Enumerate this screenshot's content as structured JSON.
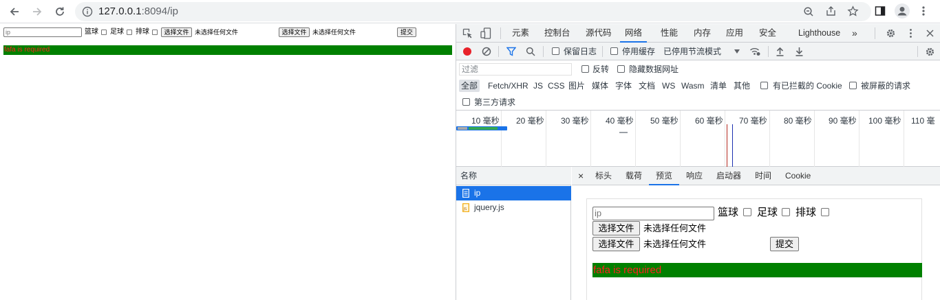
{
  "browser": {
    "url_host": "127.0.0.1",
    "url_rest": ":8094/ip"
  },
  "page": {
    "ip_placeholder": "ip",
    "hobbies": [
      "篮球",
      "足球",
      "排球"
    ],
    "file1_button": "选择文件",
    "file1_status": "未选择任何文件",
    "file2_button": "选择文件",
    "file2_status": "未选择任何文件",
    "submit": "提交",
    "error": "fafa is required",
    "error_bg": "#008000",
    "error_color": "#ff2020"
  },
  "devtools": {
    "tabs": [
      "元素",
      "控制台",
      "源代码",
      "网络",
      "性能",
      "内存",
      "应用",
      "安全",
      "Lighthouse"
    ],
    "active_tab": "网络",
    "more": "»",
    "toolbar": {
      "preserve_log": "保留日志",
      "disable_cache": "停用缓存",
      "throttle": "已停用节流模式"
    },
    "filter_placeholder": "过滤",
    "invert": "反转",
    "hide_data_urls": "隐藏数据网址",
    "types": [
      "全部",
      "Fetch/XHR",
      "JS",
      "CSS",
      "图片",
      "媒体",
      "字体",
      "文档",
      "WS",
      "Wasm",
      "清单",
      "其他"
    ],
    "blocked_cookies": "有已拦截的 Cookie",
    "blocked_requests": "被屏蔽的请求",
    "third_party": "第三方请求",
    "timeline_ticks": [
      "10 毫秒",
      "20 毫秒",
      "30 毫秒",
      "40 毫秒",
      "50 毫秒",
      "60 毫秒",
      "70 毫秒",
      "80 毫秒",
      "90 毫秒",
      "100 毫秒",
      "110 毫"
    ],
    "name_header": "名称",
    "requests": [
      "ip",
      "jquery.js"
    ],
    "detail_close": "×",
    "detail_tabs": [
      "标头",
      "载荷",
      "预览",
      "响应",
      "启动器",
      "时间",
      "Cookie"
    ],
    "detail_active": "预览"
  }
}
